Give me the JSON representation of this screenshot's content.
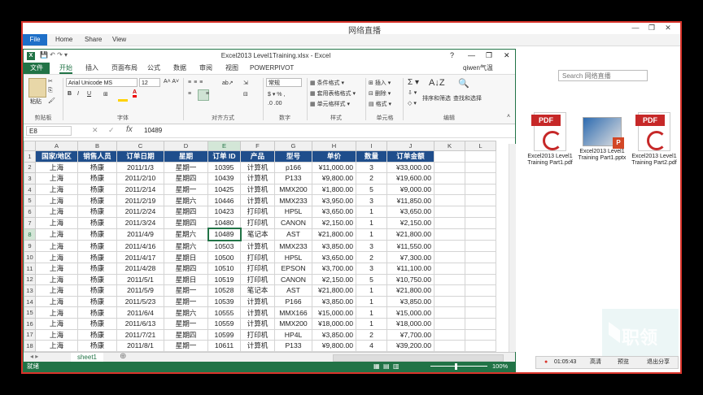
{
  "explorer": {
    "title": "网络直播",
    "tabs": [
      "File",
      "Home",
      "Share",
      "View"
    ],
    "search_placeholder": "Search 网络直播",
    "files": [
      {
        "name": "Excel2013 Level1 Training Part1.pdf",
        "type": "pdf"
      },
      {
        "name": "Excel2013 Level1 Training Part1.pptx",
        "type": "pptx"
      },
      {
        "name": "Excel2013 Level1 Training Part2.pdf",
        "type": "pdf"
      }
    ],
    "pdf_badge": "PDF"
  },
  "stream_bar": {
    "timer": "01:05:43",
    "quality": "高清",
    "preview": "预览",
    "exit": "退出分享"
  },
  "watermark": "职领",
  "excel": {
    "title": "Excel2013 Level1Training.xlsx - Excel",
    "user": "qiwen气温",
    "tabs": [
      "文件",
      "开始",
      "插入",
      "页面布局",
      "公式",
      "数据",
      "审阅",
      "视图",
      "POWERPIVOT"
    ],
    "active_tab": "开始",
    "ribbon": {
      "paste": "粘贴",
      "font_name": "Arial Unicode MS",
      "font_size": "12",
      "number_format": "常规",
      "conditional_format": "条件格式",
      "table_format": "套用表格格式",
      "cell_style": "单元格样式",
      "insert": "插入",
      "delete": "删除",
      "format": "格式",
      "sort_filter": "排序和筛选",
      "find_select": "查找和选择",
      "groups": [
        "剪贴板",
        "字体",
        "对齐方式",
        "数字",
        "样式",
        "单元格",
        "编辑"
      ]
    },
    "name_box": "E8",
    "formula": "10489",
    "columns": [
      "A",
      "B",
      "C",
      "D",
      "E",
      "F",
      "G",
      "H",
      "I",
      "J",
      "K",
      "L"
    ],
    "headers": [
      "国家/地区",
      "销售人员",
      "订单日期",
      "星期",
      "订单 ID",
      "产品",
      "型号",
      "单价",
      "数量",
      "订单金额"
    ],
    "rows": [
      [
        "上海",
        "杨康",
        "2011/1/3",
        "星期一",
        "10395",
        "计算机",
        "p166",
        "¥11,000.00",
        "3",
        "¥33,000.00"
      ],
      [
        "上海",
        "杨康",
        "2011/2/10",
        "星期四",
        "10439",
        "计算机",
        "P133",
        "¥9,800.00",
        "2",
        "¥19,600.00"
      ],
      [
        "上海",
        "杨康",
        "2011/2/14",
        "星期一",
        "10425",
        "计算机",
        "MMX200",
        "¥1,800.00",
        "5",
        "¥9,000.00"
      ],
      [
        "上海",
        "杨康",
        "2011/2/19",
        "星期六",
        "10446",
        "计算机",
        "MMX233",
        "¥3,950.00",
        "3",
        "¥11,850.00"
      ],
      [
        "上海",
        "杨康",
        "2011/2/24",
        "星期四",
        "10423",
        "打印机",
        "HP5L",
        "¥3,650.00",
        "1",
        "¥3,650.00"
      ],
      [
        "上海",
        "杨康",
        "2011/3/24",
        "星期四",
        "10480",
        "打印机",
        "CANON",
        "¥2,150.00",
        "1",
        "¥2,150.00"
      ],
      [
        "上海",
        "杨康",
        "2011/4/9",
        "星期六",
        "10489",
        "笔记本",
        "AST",
        "¥21,800.00",
        "1",
        "¥21,800.00"
      ],
      [
        "上海",
        "杨康",
        "2011/4/16",
        "星期六",
        "10503",
        "计算机",
        "MMX233",
        "¥3,850.00",
        "3",
        "¥11,550.00"
      ],
      [
        "上海",
        "杨康",
        "2011/4/17",
        "星期日",
        "10500",
        "打印机",
        "HP5L",
        "¥3,650.00",
        "2",
        "¥7,300.00"
      ],
      [
        "上海",
        "杨康",
        "2011/4/28",
        "星期四",
        "10510",
        "打印机",
        "EPSON",
        "¥3,700.00",
        "3",
        "¥11,100.00"
      ],
      [
        "上海",
        "杨康",
        "2011/5/1",
        "星期日",
        "10519",
        "打印机",
        "CANON",
        "¥2,150.00",
        "5",
        "¥10,750.00"
      ],
      [
        "上海",
        "杨康",
        "2011/5/9",
        "星期一",
        "10528",
        "笔记本",
        "AST",
        "¥21,800.00",
        "1",
        "¥21,800.00"
      ],
      [
        "上海",
        "杨康",
        "2011/5/23",
        "星期一",
        "10539",
        "计算机",
        "P166",
        "¥3,850.00",
        "1",
        "¥3,850.00"
      ],
      [
        "上海",
        "杨康",
        "2011/6/4",
        "星期六",
        "10555",
        "计算机",
        "MMX166",
        "¥15,000.00",
        "1",
        "¥15,000.00"
      ],
      [
        "上海",
        "杨康",
        "2011/6/13",
        "星期一",
        "10559",
        "计算机",
        "MMX200",
        "¥18,000.00",
        "1",
        "¥18,000.00"
      ],
      [
        "上海",
        "杨康",
        "2011/7/21",
        "星期四",
        "10599",
        "打印机",
        "HP4L",
        "¥3,850.00",
        "2",
        "¥7,700.00"
      ],
      [
        "上海",
        "杨康",
        "2011/8/1",
        "星期一",
        "10611",
        "计算机",
        "P133",
        "¥9,800.00",
        "4",
        "¥39,200.00"
      ]
    ],
    "sheet_tab": "sheet1",
    "status_ready": "就绪",
    "zoom": "100%"
  }
}
